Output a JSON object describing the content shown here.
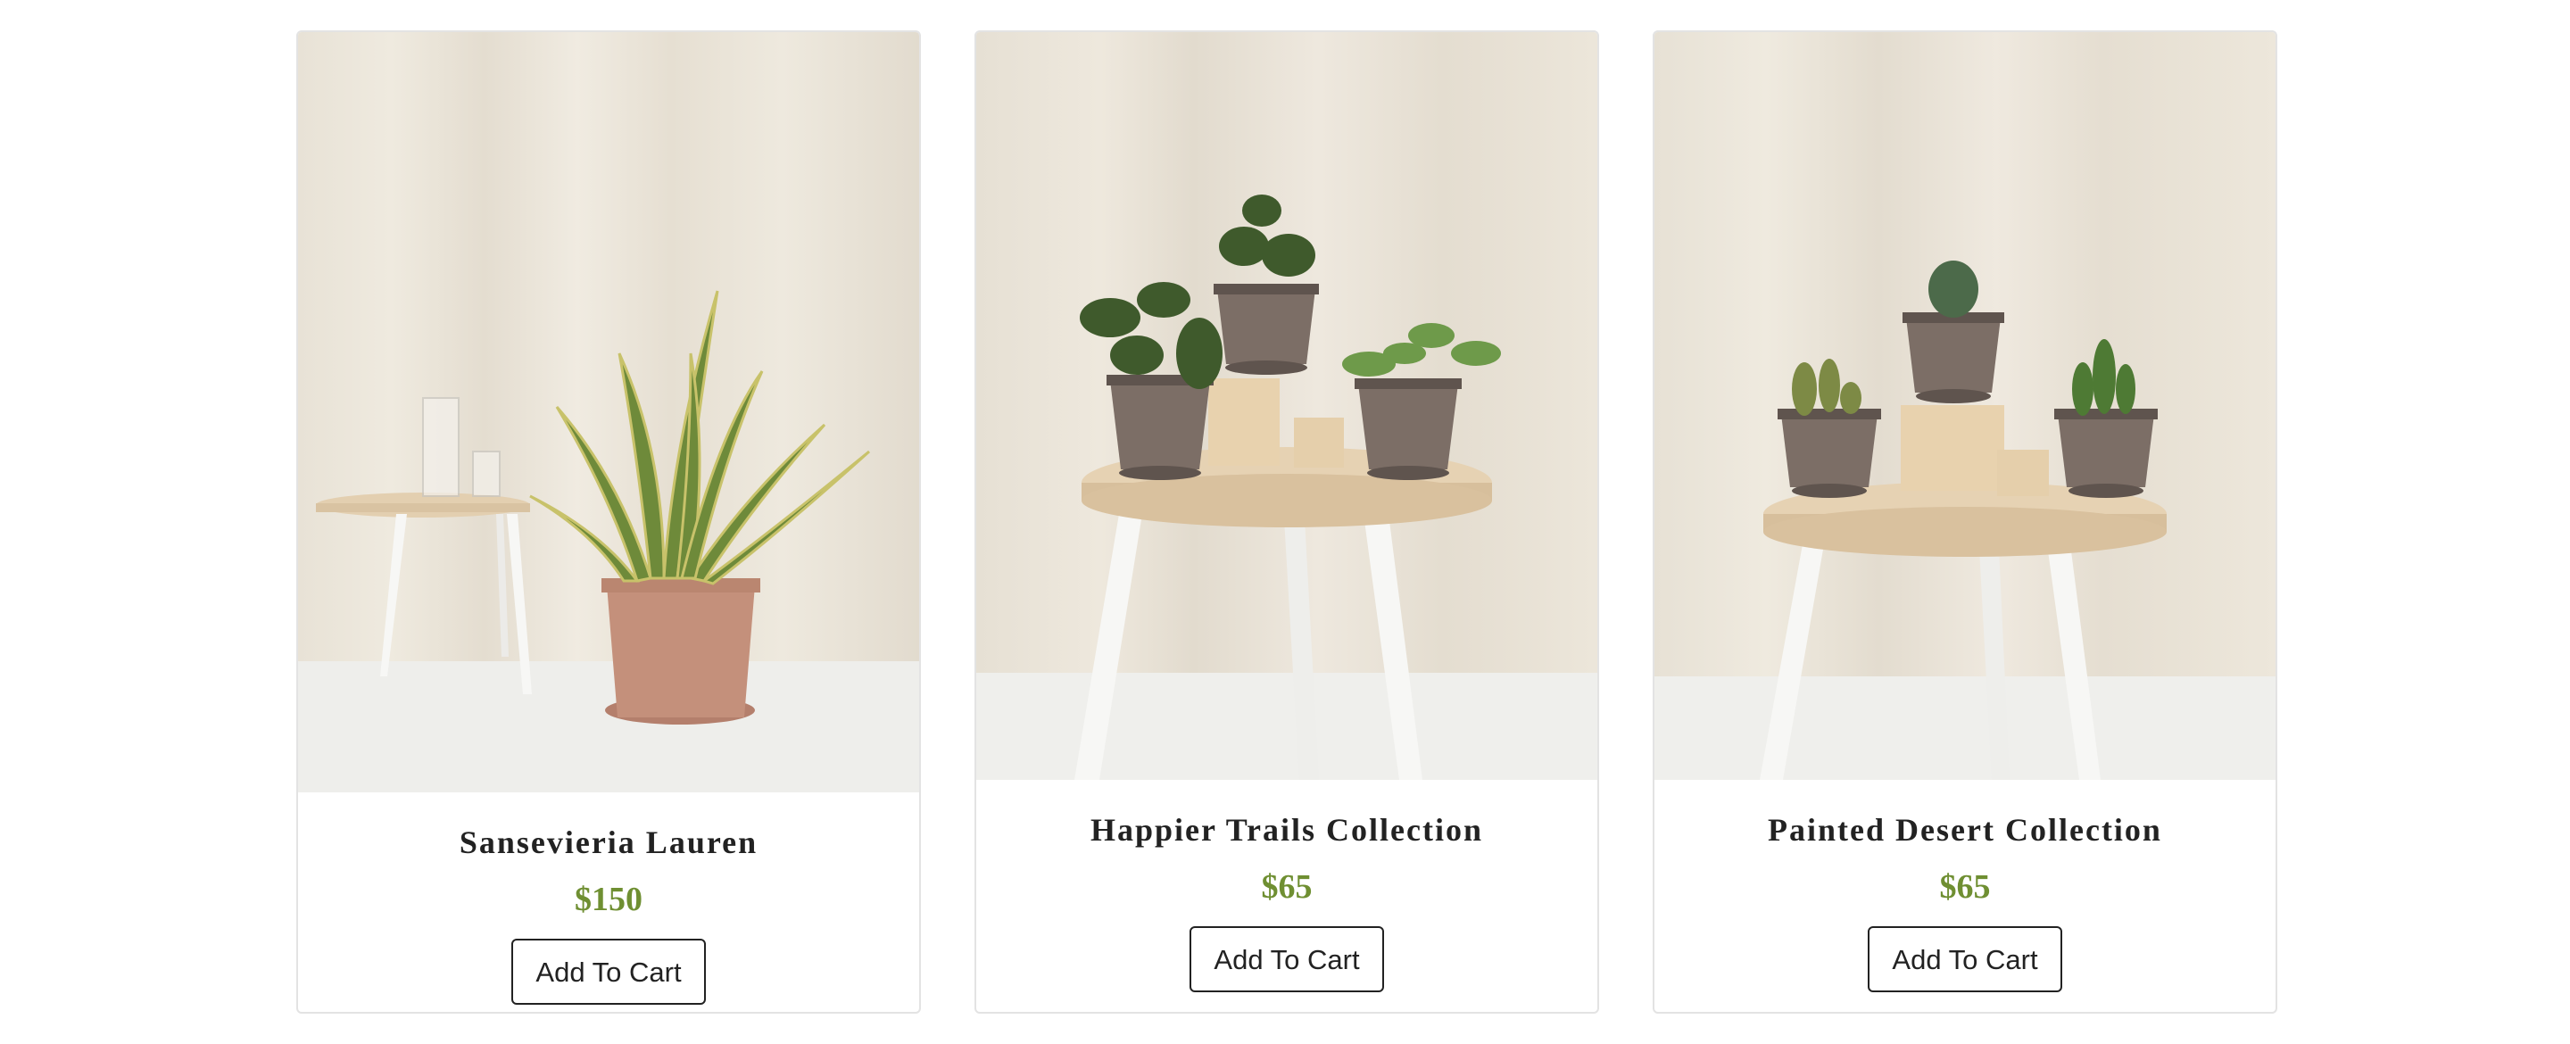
{
  "products": [
    {
      "name": "Sansevieria Lauren",
      "price": "$150",
      "button_label": "Add To Cart"
    },
    {
      "name": "Happier Trails Collection",
      "price": "$65",
      "button_label": "Add To Cart"
    },
    {
      "name": "Painted Desert Collection",
      "price": "$65",
      "button_label": "Add To Cart"
    }
  ],
  "colors": {
    "price": "#6f8f32",
    "text": "#222222",
    "backdrop": "#ece6da",
    "floor": "#efefec"
  }
}
